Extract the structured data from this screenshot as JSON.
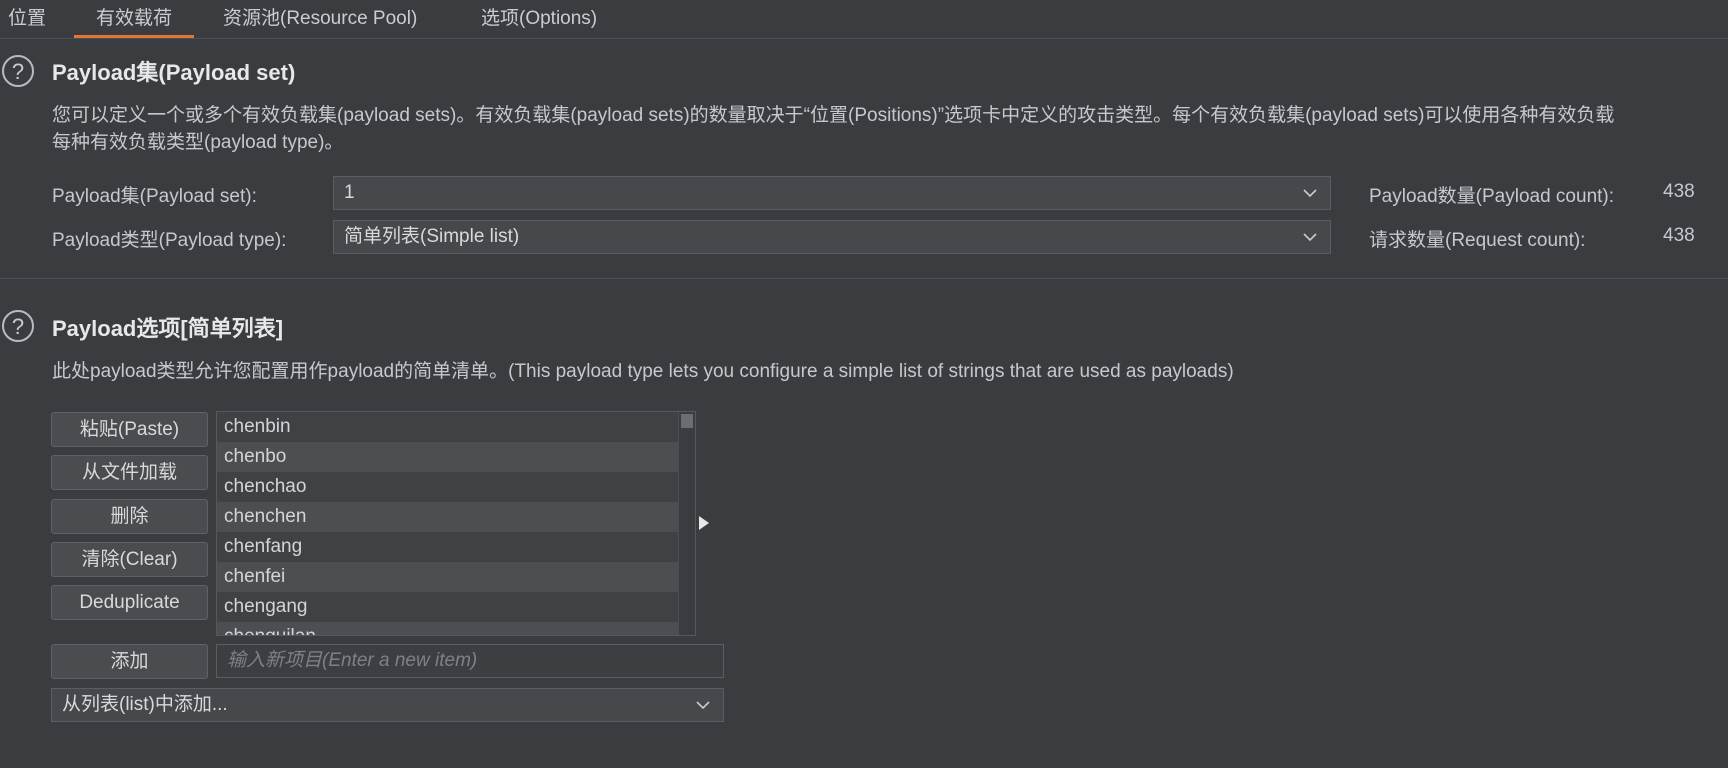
{
  "tabs": [
    "位置",
    "有效载荷",
    "资源池(Resource Pool)",
    "选项(Options)"
  ],
  "payload_sets": {
    "title": "Payload集(Payload set)",
    "desc_line1": "您可以定义一个或多个有效负载集(payload sets)。有效负载集(payload sets)的数量取决于“位置(Positions)”选项卡中定义的攻击类型。每个有效负载集(payload sets)可以使用各种有效负载",
    "desc_line2": "每种有效负载类型(payload type)。",
    "set_label": "Payload集(Payload set):",
    "set_value": "1",
    "type_label": "Payload类型(Payload type):",
    "type_value": "简单列表(Simple list)",
    "count_label": "Payload数量(Payload count):",
    "count_value": "438",
    "request_label": "请求数量(Request count):",
    "request_value": "438"
  },
  "payload_options": {
    "title": "Payload选项[简单列表]",
    "desc": "此处payload类型允许您配置用作payload的简单清单。(This payload type lets you configure a simple list of strings that are used as payloads)",
    "buttons": {
      "paste": "粘贴(Paste)",
      "load": "从文件加载",
      "remove": "删除",
      "clear": "清除(Clear)",
      "dedup": "Deduplicate",
      "add": "添加"
    },
    "items": [
      "chenbin",
      "chenbo",
      "chenchao",
      "chenchen",
      "chenfang",
      "chenfei",
      "chengang",
      "chenguilan"
    ],
    "new_item_placeholder": "输入新项目(Enter a new item)",
    "add_from_list": "从列表(list)中添加..."
  },
  "icons": {
    "help": "question-mark-icon",
    "dropdown": "chevron-down-icon",
    "arrow": "play-arrow-icon"
  },
  "colors": {
    "background": "#3a3d40",
    "accent": "#e0763a"
  }
}
